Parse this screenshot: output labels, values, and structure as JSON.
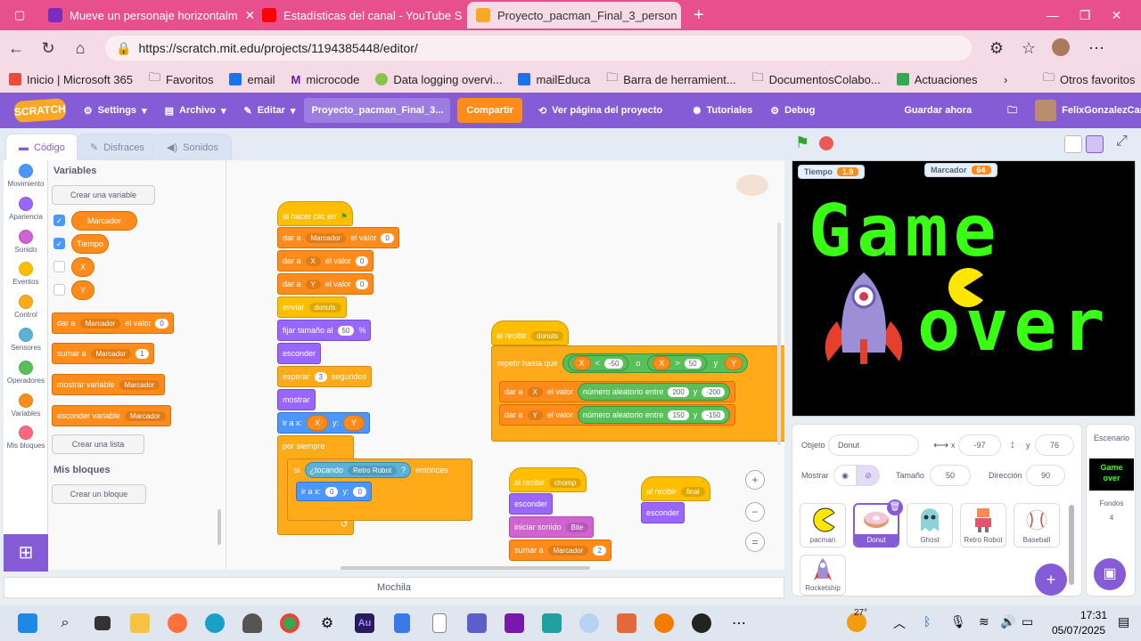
{
  "browser": {
    "tabs": [
      {
        "title": "Mueve un personaje horizontalm",
        "icon_color": "#7b2cbf"
      },
      {
        "title": "Estadísticas del canal - YouTube S",
        "icon_color": "#ff0000"
      },
      {
        "title": "Proyecto_pacman_Final_3_person",
        "icon_color": "#f9a825"
      }
    ],
    "url": "https://scratch.mit.edu/projects/1194385448/editor/",
    "bookmarks": [
      "Inicio | Microsoft 365",
      "Favoritos",
      "email",
      "microcode",
      "Data logging overvi...",
      "mailEduca",
      "Barra de herramient...",
      "DocumentosColabo...",
      "Actuaciones",
      "Otros favoritos"
    ]
  },
  "menu": {
    "logo": "SCRATCH",
    "settings": "Settings",
    "file": "Archivo",
    "edit": "Editar",
    "project_title": "Proyecto_pacman_Final_3...",
    "share": "Compartir",
    "see_project": "Ver página del proyecto",
    "tutorials": "Tutoriales",
    "debug": "Debug",
    "save": "Guardar ahora",
    "username": "FelixGonzalezCanle"
  },
  "editor_tabs": {
    "code": "Código",
    "costumes": "Disfraces",
    "sounds": "Sonidos"
  },
  "categories": [
    {
      "label": "Movimiento",
      "color": "#4c97ff"
    },
    {
      "label": "Apariencia",
      "color": "#9966ff"
    },
    {
      "label": "Sonido",
      "color": "#cf63cf"
    },
    {
      "label": "Eventos",
      "color": "#ffbf00"
    },
    {
      "label": "Control",
      "color": "#ffab19"
    },
    {
      "label": "Sensores",
      "color": "#5cb1d6"
    },
    {
      "label": "Operadores",
      "color": "#59c059"
    },
    {
      "label": "Variables",
      "color": "#ff8c1a"
    },
    {
      "label": "Mis bloques",
      "color": "#ff6680"
    }
  ],
  "palette": {
    "variables_title": "Variables",
    "make_variable": "Crear una variable",
    "vars": [
      {
        "name": "Marcador",
        "checked": true
      },
      {
        "name": "Tiempo",
        "checked": true
      },
      {
        "name": "X",
        "checked": false
      },
      {
        "name": "Y",
        "checked": false
      }
    ],
    "set_block": {
      "label": "dar a",
      "var": "Marcador",
      "mid": "el valor",
      "value": "0"
    },
    "change_block": {
      "label": "sumar a",
      "var": "Marcador",
      "value": "1"
    },
    "show_block": {
      "label": "mostrar variable",
      "var": "Marcador"
    },
    "hide_block": {
      "label": "esconder variable",
      "var": "Marcador"
    },
    "make_list": "Crear una lista",
    "my_blocks_title": "Mis bloques",
    "make_block": "Crear un bloque"
  },
  "scripts": {
    "s1": {
      "hat": "al hacer clic en",
      "b1": {
        "a": "dar a",
        "v": "Marcador",
        "b": "el valor",
        "n": "0"
      },
      "b2": {
        "a": "dar a",
        "v": "X",
        "b": "el valor",
        "n": "0"
      },
      "b3": {
        "a": "dar a",
        "v": "Y",
        "b": "el valor",
        "n": "0"
      },
      "b4": {
        "a": "enviar",
        "v": "donuts"
      },
      "b5": {
        "a": "fijar tamaño al",
        "n": "50",
        "b": "%"
      },
      "b6": "esconder",
      "b7": {
        "a": "esperar",
        "n": "3",
        "b": "segundos"
      },
      "b8": "mostrar",
      "b9": {
        "a": "ir a x:",
        "x": "X",
        "ylbl": "y:",
        "y": "Y"
      },
      "forever": "por siempre",
      "if_a": "si",
      "if_cond": "¿tocando",
      "if_target": "Retro Robot",
      "if_q": "?",
      "if_b": "entonces",
      "goto": {
        "a": "ir a x:",
        "x": "0",
        "ylbl": "y:",
        "y": "0"
      }
    },
    "s2": {
      "hat": "al recibir",
      "msg": "donuts",
      "repeat": "repetir hasta que",
      "c1": {
        "v": "X",
        "op": "<",
        "n": "-50"
      },
      "or": "o",
      "c2": {
        "v": "X",
        "op": ">",
        "n": "50"
      },
      "and": "y",
      "c3": "Y",
      "set1": {
        "a": "dar a",
        "v": "X",
        "b": "el valor",
        "r": "número aleatorio entre",
        "n1": "200",
        "y": "y",
        "n2": "-200"
      },
      "set2": {
        "a": "dar a",
        "v": "Y",
        "b": "el valor",
        "r": "número aleatorio entre",
        "n1": "150",
        "y": "y",
        "n2": "-150"
      }
    },
    "s3": {
      "hat": "al recibir",
      "msg": "chomp",
      "b1": "esconder",
      "b2": {
        "a": "iniciar sonido",
        "v": "Bite"
      },
      "b3": {
        "a": "sumar a",
        "v": "Marcador",
        "n": "2"
      }
    },
    "s4": {
      "hat": "al recibir",
      "msg": "final",
      "b1": "esconder"
    }
  },
  "backpack": "Mochila",
  "stage": {
    "monitor_time": {
      "label": "Tiempo",
      "value": "1.9"
    },
    "monitor_score": {
      "label": "Marcador",
      "value": "64"
    },
    "line1": "Game",
    "line2": "over"
  },
  "sprite_info": {
    "sprite_label": "Objeto",
    "sprite_name": "Donut",
    "x_label": "x",
    "x": "-97",
    "y_label": "y",
    "y": "76",
    "show_label": "Mostrar",
    "size_label": "Tamaño",
    "size": "50",
    "dir_label": "Dirección",
    "dir": "90"
  },
  "sprites": [
    "pacman",
    "Donut",
    "Ghost",
    "Retro Robot",
    "Baseball",
    "Rocketship"
  ],
  "stage_panel": {
    "title": "Escenario",
    "thumb_line1": "Game",
    "thumb_line2": "over",
    "bg_label": "Fondos",
    "bg_count": "4"
  },
  "taskbar": {
    "weather": "27°",
    "time": "17:31",
    "date": "05/07/2025"
  }
}
